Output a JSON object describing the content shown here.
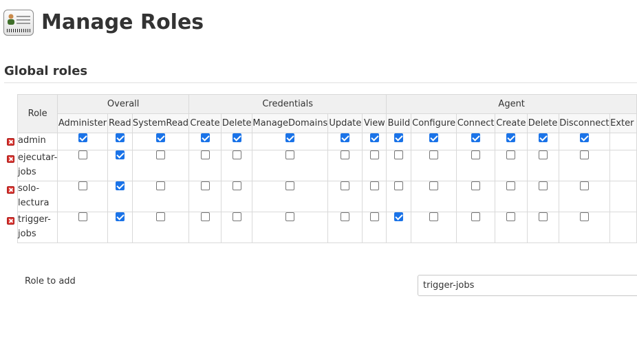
{
  "page": {
    "title": "Manage Roles"
  },
  "section": {
    "title": "Global roles"
  },
  "table": {
    "role_header": "Role",
    "groups": [
      {
        "label": "Overall",
        "span": 3
      },
      {
        "label": "Credentials",
        "span": 5
      },
      {
        "label": "Agent",
        "span": 7
      }
    ],
    "permissions": [
      "Administer",
      "Read",
      "SystemRead",
      "Create",
      "Delete",
      "ManageDomains",
      "Update",
      "View",
      "Build",
      "Configure",
      "Connect",
      "Create",
      "Delete",
      "Disconnect",
      "Exter"
    ],
    "roles": [
      {
        "name": "admin",
        "checks": [
          true,
          true,
          true,
          true,
          true,
          true,
          true,
          true,
          true,
          true,
          true,
          true,
          true,
          true
        ]
      },
      {
        "name": "ejecutar-jobs",
        "checks": [
          false,
          true,
          false,
          false,
          false,
          false,
          false,
          false,
          false,
          false,
          false,
          false,
          false,
          false
        ]
      },
      {
        "name": "solo-lectura",
        "checks": [
          false,
          true,
          false,
          false,
          false,
          false,
          false,
          false,
          false,
          false,
          false,
          false,
          false,
          false
        ]
      },
      {
        "name": "trigger-jobs",
        "checks": [
          false,
          true,
          false,
          false,
          false,
          false,
          false,
          false,
          true,
          false,
          false,
          false,
          false,
          false
        ]
      }
    ]
  },
  "add_role": {
    "label": "Role to add",
    "value": "trigger-jobs"
  },
  "icons": {
    "header": "id-badge-icon",
    "remove": "remove-icon"
  },
  "colors": {
    "checkbox_checked": "#1a73e8",
    "remove": "#d9302c"
  }
}
